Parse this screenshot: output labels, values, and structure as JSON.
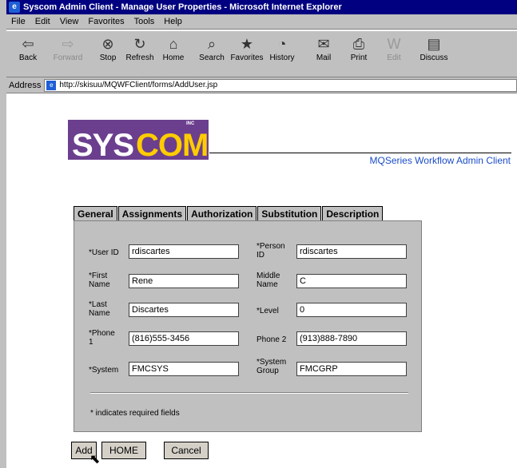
{
  "window": {
    "title": "Syscom Admin Client - Manage User Properties - Microsoft Internet Explorer"
  },
  "menu": [
    "File",
    "Edit",
    "View",
    "Favorites",
    "Tools",
    "Help"
  ],
  "toolbar": {
    "back": "Back",
    "forward": "Forward",
    "stop": "Stop",
    "refresh": "Refresh",
    "home": "Home",
    "search": "Search",
    "favorites": "Favorites",
    "history": "History",
    "mail": "Mail",
    "print": "Print",
    "edit": "Edit",
    "discuss": "Discuss"
  },
  "address": {
    "label": "Address",
    "url": "http://skisuu/MQWFClient/forms/AddUser.jsp"
  },
  "logo": {
    "sys": "SYS",
    "com": "COM",
    "inc": "INC"
  },
  "product_title": "MQSeries Workflow Admin Client",
  "tabs": [
    "General",
    "Assignments",
    "Authorization",
    "Substitution",
    "Description"
  ],
  "form": {
    "user_id_label": "*User ID",
    "user_id": "rdiscartes",
    "person_id_label": "*Person ID",
    "person_id": "rdiscartes",
    "first_name_label": "*First Name",
    "first_name": "Rene",
    "middle_name_label": "Middle Name",
    "middle_name": "C",
    "last_name_label": "*Last Name",
    "last_name": "Discartes",
    "level_label": "*Level",
    "level": "0",
    "phone1_label": "*Phone 1",
    "phone1": "(816)555-3456",
    "phone2_label": "Phone 2",
    "phone2": "(913)888-7890",
    "system_label": "*System",
    "system": "FMCSYS",
    "system_group_label": "*System Group",
    "system_group": "FMCGRP",
    "required_note": "* indicates required fields"
  },
  "buttons": {
    "add": "Add",
    "home": "HOME",
    "cancel": "Cancel"
  }
}
